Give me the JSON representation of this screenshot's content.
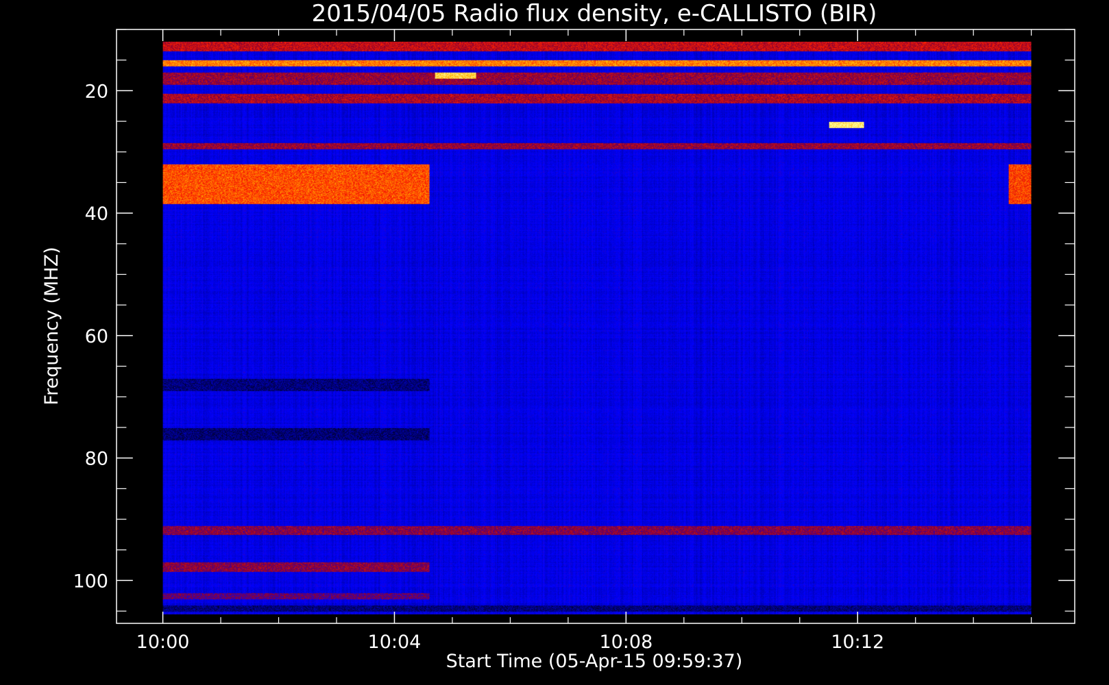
{
  "chart_data": {
    "type": "heatmap",
    "title": "2015/04/05  Radio flux density, e-CALLISTO (BIR)",
    "xlabel": "Start Time (05-Apr-15 09:59:37)",
    "ylabel": "Frequency (MHZ)",
    "x_axis": {
      "unit": "minutes after 10:00",
      "range": [
        -0.8,
        15.75
      ],
      "ticks": [
        {
          "value": 0,
          "label": "10:00"
        },
        {
          "value": 4,
          "label": "10:04"
        },
        {
          "value": 8,
          "label": "10:08"
        },
        {
          "value": 12,
          "label": "10:12"
        }
      ],
      "minor_step": 1
    },
    "y_axis": {
      "unit": "MHz",
      "range": [
        10,
        107
      ],
      "inverted": true,
      "ticks": [
        {
          "value": 20,
          "label": "20"
        },
        {
          "value": 40,
          "label": "40"
        },
        {
          "value": 60,
          "label": "60"
        },
        {
          "value": 80,
          "label": "80"
        },
        {
          "value": 100,
          "label": "100"
        }
      ],
      "minor_step": 5
    },
    "data_extent": {
      "time_start": 0,
      "time_end": 15,
      "freq_min": 12,
      "freq_max": 105.5
    },
    "colormap": [
      "#000000",
      "#00008a",
      "#0000ff",
      "#8a0030",
      "#ff2000",
      "#ffb000",
      "#ffffa0"
    ],
    "background_level": 0.3,
    "features": [
      {
        "name": "interference band",
        "t0": 0,
        "t1": 15,
        "f0": 12,
        "f1": 13.5,
        "level": 0.58
      },
      {
        "name": "interference band",
        "t0": 0,
        "t1": 15,
        "f0": 15,
        "f1": 16,
        "level": 0.78
      },
      {
        "name": "interference band",
        "t0": 0,
        "t1": 15,
        "f0": 17,
        "f1": 19,
        "level": 0.52
      },
      {
        "name": "interference band",
        "t0": 0,
        "t1": 15,
        "f0": 20.5,
        "f1": 22,
        "level": 0.55
      },
      {
        "name": "interference band",
        "t0": 0,
        "t1": 15,
        "f0": 28.5,
        "f1": 29.5,
        "level": 0.52
      },
      {
        "name": "strong emission",
        "t0": 0,
        "t1": 4.6,
        "f0": 32,
        "f1": 38.5,
        "level": 0.72
      },
      {
        "name": "strong emission",
        "t0": 14.6,
        "t1": 15,
        "f0": 32,
        "f1": 38.5,
        "level": 0.7
      },
      {
        "name": "dark band",
        "t0": 0,
        "t1": 4.6,
        "f0": 67,
        "f1": 69,
        "level": 0.15
      },
      {
        "name": "dark band",
        "t0": 0,
        "t1": 4.6,
        "f0": 75,
        "f1": 77,
        "level": 0.14
      },
      {
        "name": "red band",
        "t0": 0,
        "t1": 15,
        "f0": 91,
        "f1": 92.5,
        "level": 0.5
      },
      {
        "name": "red band",
        "t0": 0,
        "t1": 4.6,
        "f0": 97,
        "f1": 98.5,
        "level": 0.5
      },
      {
        "name": "red band",
        "t0": 0,
        "t1": 4.6,
        "f0": 102,
        "f1": 103,
        "level": 0.45
      },
      {
        "name": "dark band",
        "t0": 0,
        "t1": 15,
        "f0": 104,
        "f1": 105,
        "level": 0.15
      },
      {
        "name": "hot spot",
        "t0": 4.7,
        "t1": 5.4,
        "f0": 17,
        "f1": 18,
        "level": 0.9
      },
      {
        "name": "hot spot",
        "t0": 11.5,
        "t1": 12.1,
        "f0": 25,
        "f1": 26,
        "level": 0.96
      }
    ]
  }
}
